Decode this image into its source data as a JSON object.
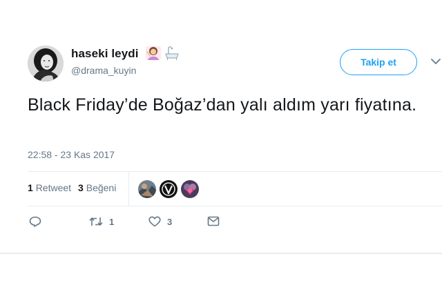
{
  "user": {
    "display_name": "haseki leydi",
    "handle": "@drama_kuyin",
    "name_emojis": [
      "woman-gesturing-icon",
      "bathtub-icon"
    ]
  },
  "follow_button": {
    "label": "Takip et"
  },
  "tweet": {
    "text": "Black Friday’de Boğaz’dan yalı aldım yarı fiyatına.",
    "timestamp": "22:58 - 23 Kas 2017"
  },
  "stats": {
    "retweet_count": "1",
    "retweet_label": "Retweet",
    "like_count": "3",
    "like_label": "Beğeni"
  },
  "likers": [
    "liker-avatar-1",
    "liker-avatar-2",
    "liker-avatar-3"
  ],
  "actions": {
    "reply": {
      "icon": "reply-icon",
      "count": ""
    },
    "retweet": {
      "icon": "retweet-icon",
      "count": "1"
    },
    "like": {
      "icon": "heart-icon",
      "count": "3"
    },
    "dm": {
      "icon": "envelope-icon",
      "count": ""
    }
  },
  "colors": {
    "accent": "#1da1f2",
    "text": "#14171a",
    "secondary": "#657786",
    "divider": "#e6ecf0"
  }
}
